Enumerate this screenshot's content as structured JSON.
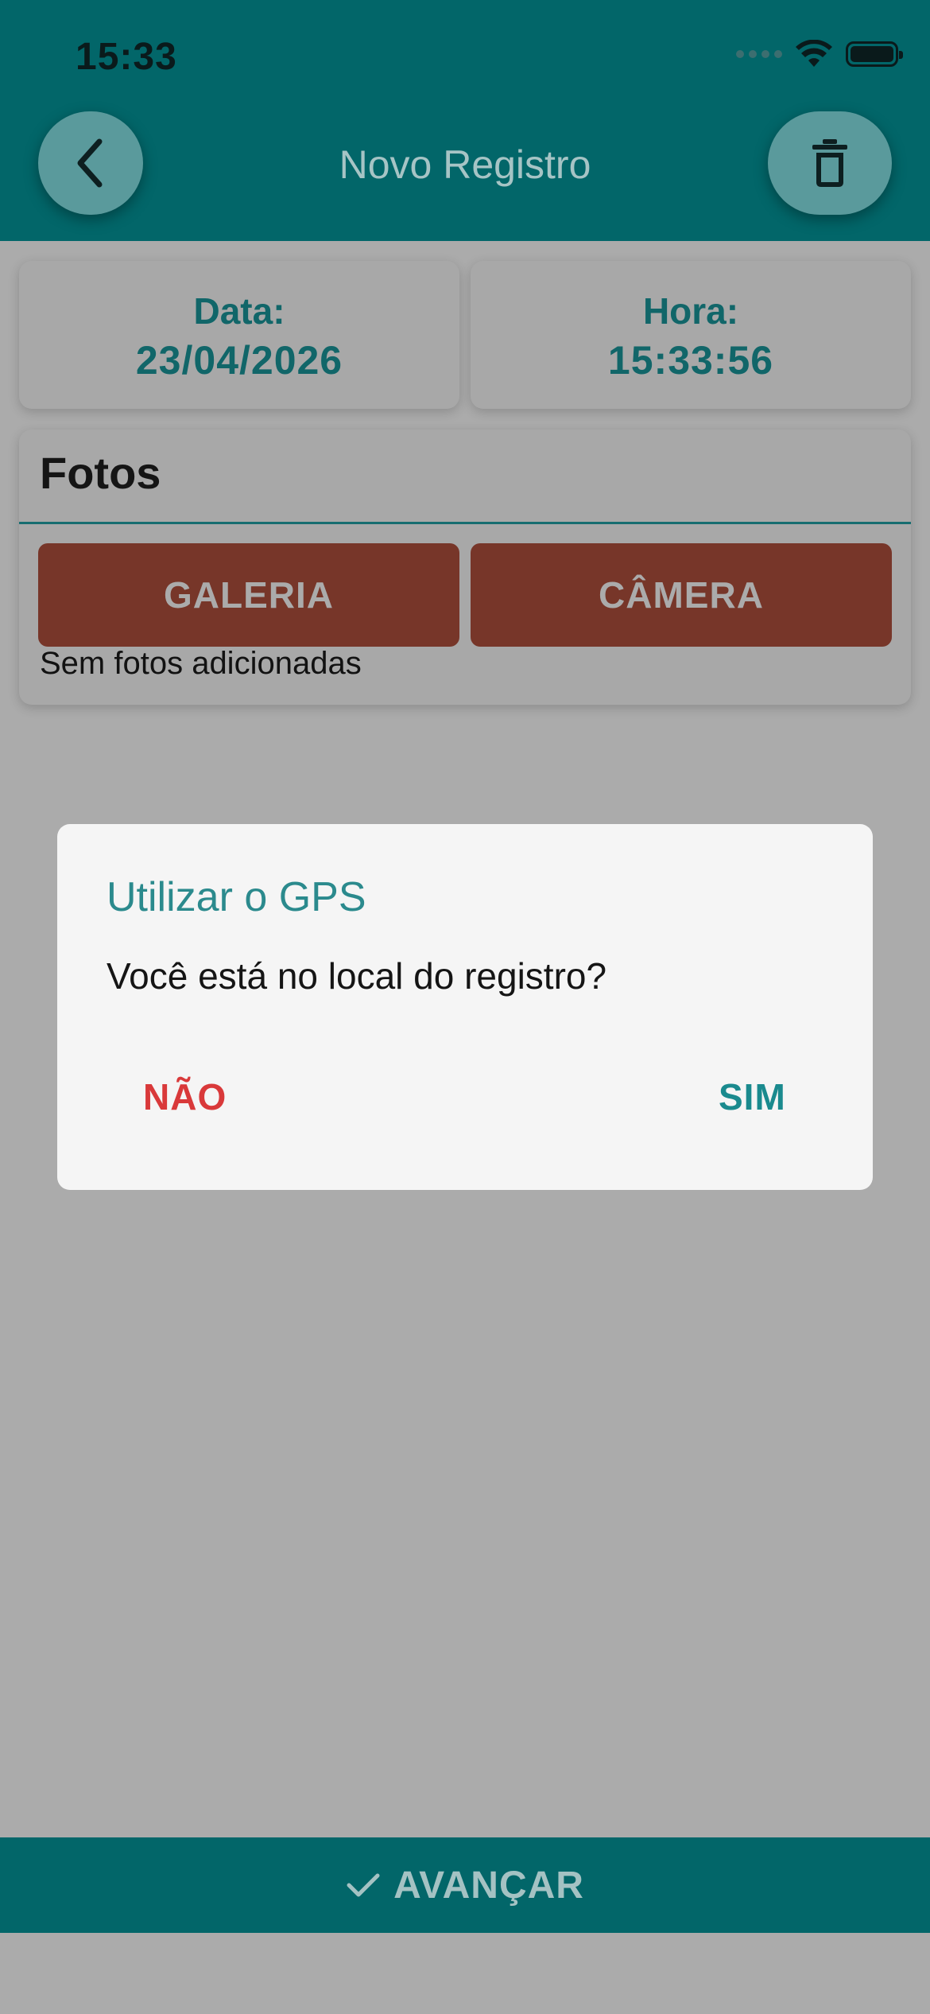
{
  "status_bar": {
    "time": "15:33"
  },
  "header": {
    "title": "Novo Registro",
    "back_icon": "chevron-left-icon",
    "delete_icon": "trash-icon"
  },
  "date_card": {
    "label": "Data:",
    "value": "23/04/2026"
  },
  "time_card": {
    "label": "Hora:",
    "value": "15:33:56"
  },
  "fotos": {
    "title": "Fotos",
    "gallery_label": "GALERIA",
    "camera_label": "CÂMERA",
    "empty_message": "Sem fotos adicionadas"
  },
  "dialog": {
    "title": "Utilizar o GPS",
    "message": "Você está no local do registro?",
    "no_label": "NÃO",
    "yes_label": "SIM"
  },
  "footer": {
    "next_label": "AVANÇAR",
    "next_icon": "check-icon"
  },
  "colors": {
    "primary": "#026669",
    "accent": "#773629",
    "danger": "#d9393a",
    "title_teal": "#2b8a8d"
  }
}
